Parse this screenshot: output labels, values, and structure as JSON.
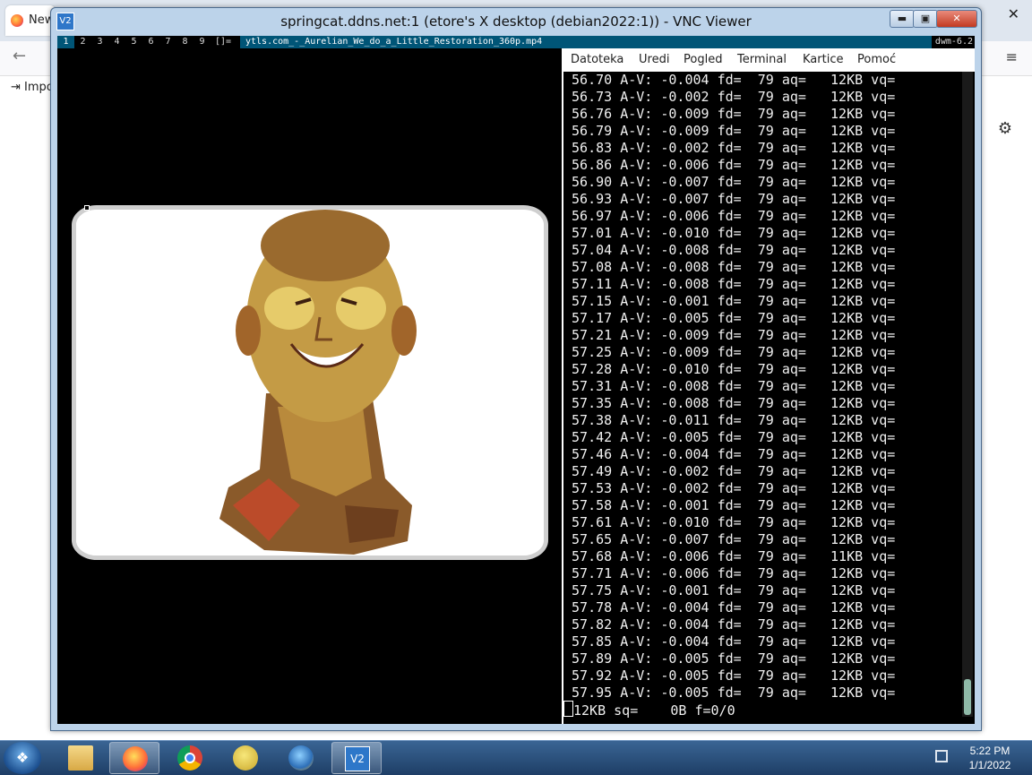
{
  "background_browser": {
    "tab_label": "New",
    "import_label": "Impo"
  },
  "vnc_window": {
    "title": "springcat.ddns.net:1 (etore's X desktop (debian2022:1)) - VNC Viewer",
    "logo_text": "V2",
    "minimize": "▬",
    "maximize": "▣",
    "close": "✕"
  },
  "dwm": {
    "tags": [
      "1",
      "2",
      "3",
      "4",
      "5",
      "6",
      "7",
      "8",
      "9"
    ],
    "selected_tag": "1",
    "layout": "[]=",
    "window_title": "ytls.com_-_Aurelian_We_do_a_Little_Restoration_360p.mp4",
    "status": "dwm-6.2"
  },
  "terminal": {
    "menu": [
      "Datoteka",
      "Uredi",
      "Pogled",
      "Terminal",
      "Kartice",
      "Pomoć"
    ],
    "lines": [
      " 56.70 A-V: -0.004 fd=  79 aq=   12KB vq=",
      " 56.73 A-V: -0.002 fd=  79 aq=   12KB vq=",
      " 56.76 A-V: -0.009 fd=  79 aq=   12KB vq=",
      " 56.79 A-V: -0.009 fd=  79 aq=   12KB vq=",
      " 56.83 A-V: -0.002 fd=  79 aq=   12KB vq=",
      " 56.86 A-V: -0.006 fd=  79 aq=   12KB vq=",
      " 56.90 A-V: -0.007 fd=  79 aq=   12KB vq=",
      " 56.93 A-V: -0.007 fd=  79 aq=   12KB vq=",
      " 56.97 A-V: -0.006 fd=  79 aq=   12KB vq=",
      " 57.01 A-V: -0.010 fd=  79 aq=   12KB vq=",
      " 57.04 A-V: -0.008 fd=  79 aq=   12KB vq=",
      " 57.08 A-V: -0.008 fd=  79 aq=   12KB vq=",
      " 57.11 A-V: -0.008 fd=  79 aq=   12KB vq=",
      " 57.15 A-V: -0.001 fd=  79 aq=   12KB vq=",
      " 57.17 A-V: -0.005 fd=  79 aq=   12KB vq=",
      " 57.21 A-V: -0.009 fd=  79 aq=   12KB vq=",
      " 57.25 A-V: -0.009 fd=  79 aq=   12KB vq=",
      " 57.28 A-V: -0.010 fd=  79 aq=   12KB vq=",
      " 57.31 A-V: -0.008 fd=  79 aq=   12KB vq=",
      " 57.35 A-V: -0.008 fd=  79 aq=   12KB vq=",
      " 57.38 A-V: -0.011 fd=  79 aq=   12KB vq=",
      " 57.42 A-V: -0.005 fd=  79 aq=   12KB vq=",
      " 57.46 A-V: -0.004 fd=  79 aq=   12KB vq=",
      " 57.49 A-V: -0.002 fd=  79 aq=   12KB vq=",
      " 57.53 A-V: -0.002 fd=  79 aq=   12KB vq=",
      " 57.58 A-V: -0.001 fd=  79 aq=   12KB vq=",
      " 57.61 A-V: -0.010 fd=  79 aq=   12KB vq=",
      " 57.65 A-V: -0.007 fd=  79 aq=   12KB vq=",
      " 57.68 A-V: -0.006 fd=  79 aq=   11KB vq=",
      " 57.71 A-V: -0.006 fd=  79 aq=   12KB vq=",
      " 57.75 A-V: -0.001 fd=  79 aq=   12KB vq=",
      " 57.78 A-V: -0.004 fd=  79 aq=   12KB vq=",
      " 57.82 A-V: -0.004 fd=  79 aq=   12KB vq=",
      " 57.85 A-V: -0.004 fd=  79 aq=   12KB vq=",
      " 57.89 A-V: -0.005 fd=  79 aq=   12KB vq=",
      " 57.92 A-V: -0.005 fd=  79 aq=   12KB vq=",
      " 57.95 A-V: -0.005 fd=  79 aq=   12KB vq="
    ],
    "prompt_line": "12KB sq=    0B f=0/0"
  },
  "taskbar": {
    "apps": [
      {
        "name": "windows-explorer",
        "icon": "folder-icon"
      },
      {
        "name": "firefox",
        "icon": "firefox-icon"
      },
      {
        "name": "chrome",
        "icon": "chrome-icon"
      },
      {
        "name": "pidgin",
        "icon": "pidgin-icon"
      },
      {
        "name": "thunderbird",
        "icon": "thunderbird-icon"
      },
      {
        "name": "vnc-viewer",
        "icon": "vnc-icon",
        "label": "V2"
      }
    ],
    "clock_time": "5:22 PM",
    "clock_date": "1/1/2022"
  },
  "colors": {
    "dwm_accent": "#005577",
    "terminal_bg": "#000000",
    "taskbar": "#1e3e66"
  }
}
